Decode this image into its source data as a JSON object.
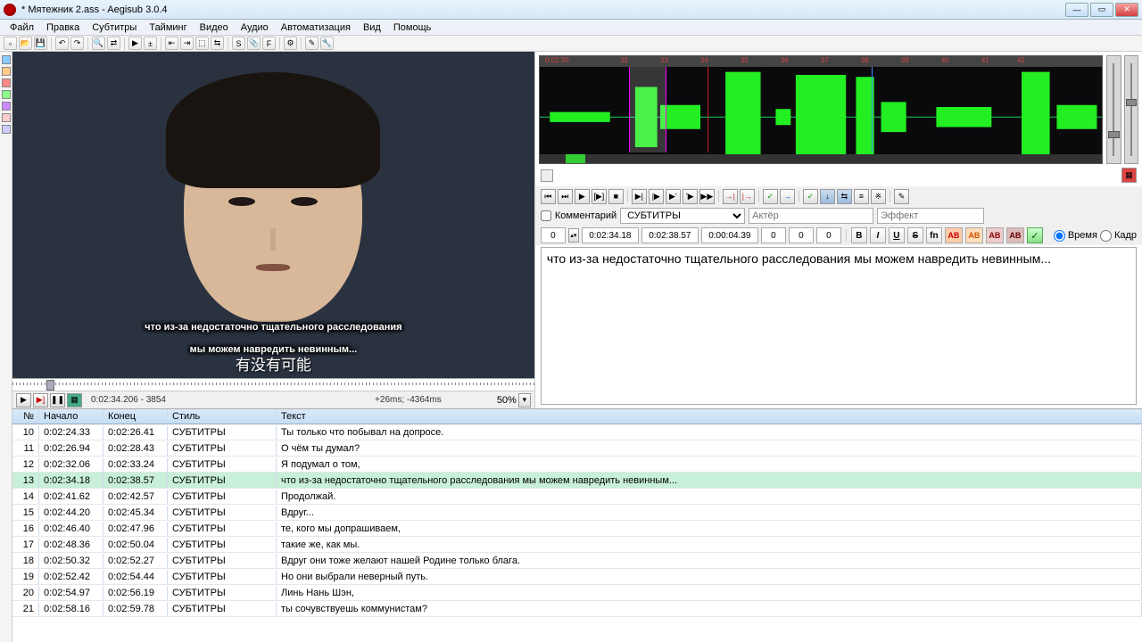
{
  "window": {
    "title": "* Мятежник 2.ass - Aegisub 3.0.4"
  },
  "menu": [
    "Файл",
    "Правка",
    "Субтитры",
    "Тайминг",
    "Видео",
    "Аудио",
    "Автоматизация",
    "Вид",
    "Помощь"
  ],
  "video": {
    "sub_line1": "что из-за недостаточно тщательного расследования",
    "sub_line2": "мы можем навредить невинным...",
    "cn_sub": "有没有可能",
    "timecode": "0:02:34.206 - 3854",
    "offset": "+26ms; -4364ms",
    "zoom": "50%"
  },
  "audio_marks": [
    "0:02:30",
    "32",
    "33",
    "34",
    "35",
    "36",
    "37",
    "38",
    "39",
    "40",
    "41",
    "42"
  ],
  "edit": {
    "comment_label": "Комментарий",
    "style": "СУБТИТРЫ",
    "actor_label": "Актёр",
    "effect_label": "Эффект",
    "layer": "0",
    "start": "0:02:34.18",
    "end": "0:02:38.57",
    "dur": "0:00:04.39",
    "marL": "0",
    "marR": "0",
    "marV": "0",
    "time_label": "Время",
    "frame_label": "Кадр",
    "text": "что из-за недостаточно тщательного расследования мы можем навредить невинным..."
  },
  "grid": {
    "hdr": {
      "n": "№",
      "start": "Начало",
      "end": "Конец",
      "style": "Стиль",
      "text": "Текст"
    },
    "rows": [
      {
        "n": "10",
        "s": "0:02:24.33",
        "e": "0:02:26.41",
        "st": "СУБТИТРЫ",
        "t": "Ты только что побывал на допросе."
      },
      {
        "n": "11",
        "s": "0:02:26.94",
        "e": "0:02:28.43",
        "st": "СУБТИТРЫ",
        "t": "О чём ты думал?"
      },
      {
        "n": "12",
        "s": "0:02:32.06",
        "e": "0:02:33.24",
        "st": "СУБТИТРЫ",
        "t": "Я подумал о том,"
      },
      {
        "n": "13",
        "s": "0:02:34.18",
        "e": "0:02:38.57",
        "st": "СУБТИТРЫ",
        "t": "что из-за недостаточно тщательного расследования мы можем навредить невинным...",
        "sel": true
      },
      {
        "n": "14",
        "s": "0:02:41.62",
        "e": "0:02:42.57",
        "st": "СУБТИТРЫ",
        "t": "Продолжай."
      },
      {
        "n": "15",
        "s": "0:02:44.20",
        "e": "0:02:45.34",
        "st": "СУБТИТРЫ",
        "t": "Вдруг..."
      },
      {
        "n": "16",
        "s": "0:02:46.40",
        "e": "0:02:47.96",
        "st": "СУБТИТРЫ",
        "t": "те, кого мы допрашиваем,"
      },
      {
        "n": "17",
        "s": "0:02:48.36",
        "e": "0:02:50.04",
        "st": "СУБТИТРЫ",
        "t": "такие же, как мы."
      },
      {
        "n": "18",
        "s": "0:02:50.32",
        "e": "0:02:52.27",
        "st": "СУБТИТРЫ",
        "t": "Вдруг они тоже желают нашей Родине только блага."
      },
      {
        "n": "19",
        "s": "0:02:52.42",
        "e": "0:02:54.44",
        "st": "СУБТИТРЫ",
        "t": "Но они выбрали неверный путь."
      },
      {
        "n": "20",
        "s": "0:02:54.97",
        "e": "0:02:56.19",
        "st": "СУБТИТРЫ",
        "t": "Линь Нань Шэн,"
      },
      {
        "n": "21",
        "s": "0:02:58.16",
        "e": "0:02:59.78",
        "st": "СУБТИТРЫ",
        "t": "ты сочувствуешь коммунистам?"
      }
    ]
  }
}
